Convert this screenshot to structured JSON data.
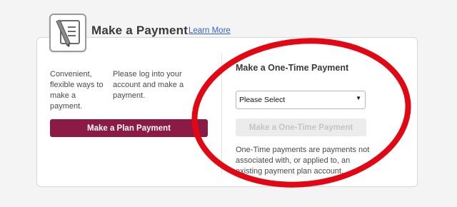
{
  "header": {
    "title": "Make a Payment",
    "learn_more": "Learn More",
    "icon": "payment-document-pen-icon"
  },
  "left": {
    "col1": "Convenient, flexible ways to make a payment.",
    "col2": "Please log into your account and make a payment.",
    "plan_button": "Make a Plan Payment"
  },
  "right": {
    "title": "Make a One-Time Payment",
    "select": {
      "value": "Please Select",
      "arrow_icon": "caret-down-icon"
    },
    "onetime_button": "Make a One-Time Payment",
    "description": "One-Time payments are payments not associated with, or applied to, an existing payment plan account."
  },
  "colors": {
    "plan_button": "#8b1a45",
    "link": "#3763c4",
    "highlight_circle": "#e30613",
    "disabled_button_bg": "#ececec"
  }
}
